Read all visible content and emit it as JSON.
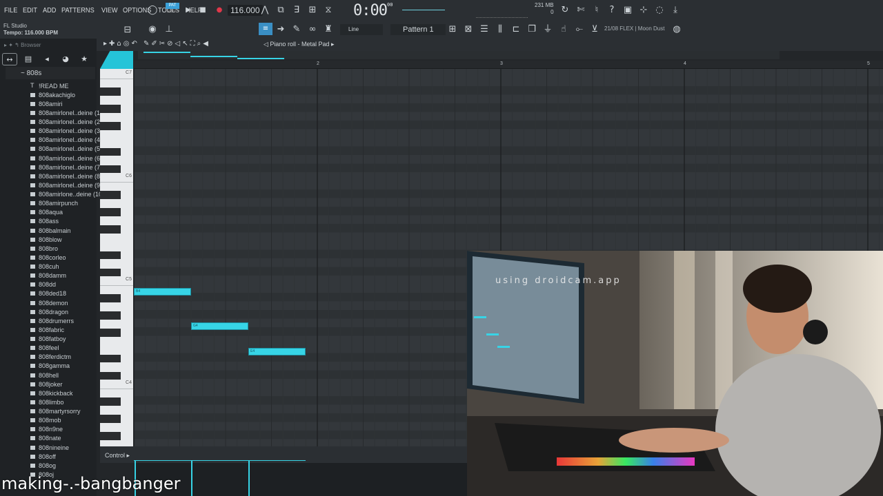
{
  "menu": [
    "FILE",
    "EDIT",
    "ADD",
    "PATTERNS",
    "VIEW",
    "OPTIONS",
    "TOOLS",
    "HELP"
  ],
  "transport": {
    "tempo_value": "116.000",
    "time": "0:00",
    "time_small": "00",
    "mode_label": "PAT",
    "mode_sub": "SONG"
  },
  "memory": {
    "top": "231 MB",
    "bottom": "0"
  },
  "app_info": {
    "name": "FL Studio",
    "tempo": "Tempo: 116.000 BPM"
  },
  "toolbar2": {
    "line_mode": "Line",
    "pattern": "Pattern 1",
    "preset": "21/08  FLEX | Moon Dust"
  },
  "sidebar": {
    "browser_label": "Browser",
    "folder": "~ 808s",
    "files": [
      "!READ ME",
      "808akachiglo",
      "808amiri",
      "808amirlonel..deine (1)",
      "808amirlonel..deine (2)",
      "808amirlonel..deine (3)",
      "808amirlonel..deine (4)",
      "808amirlonel..deine (5)",
      "808amirlonel..deine (6)",
      "808amirlonel..deine (7)",
      "808amirlonel..deine (8)",
      "808amirlonel..deine (9)",
      "808amirlone..deine (10)",
      "808amirpunch",
      "808aqua",
      "808ass",
      "808balmain",
      "808blow",
      "808bro",
      "808corleo",
      "808cuh",
      "808damm",
      "808dd",
      "808ded18",
      "808demon",
      "808dragon",
      "808drumerrs",
      "808fabric",
      "808fatboy",
      "808feel",
      "808ferdictm",
      "808gamma",
      "808hell",
      "808joker",
      "808kickback",
      "808limbo",
      "808martyrsorry",
      "808mob",
      "808n9ne",
      "808nate",
      "808nineine",
      "808off",
      "808og",
      "808oj"
    ]
  },
  "piano_roll": {
    "title": "Piano roll - Metal Pad",
    "bars": [
      "2",
      "3",
      "4",
      "5"
    ],
    "octave_labels": [
      "C7",
      "C6",
      "C5",
      "C4"
    ],
    "notes": [
      {
        "label": "B4"
      },
      {
        "label": "G4"
      },
      {
        "label": "E4"
      }
    ],
    "control_label": "Control"
  },
  "webcam": {
    "caption": "using droidcam.app"
  },
  "overlay_title": "making-.-bangbanger",
  "colors": {
    "accent": "#37d4e6",
    "grid": "#33373b",
    "panel": "#2b2f33"
  }
}
